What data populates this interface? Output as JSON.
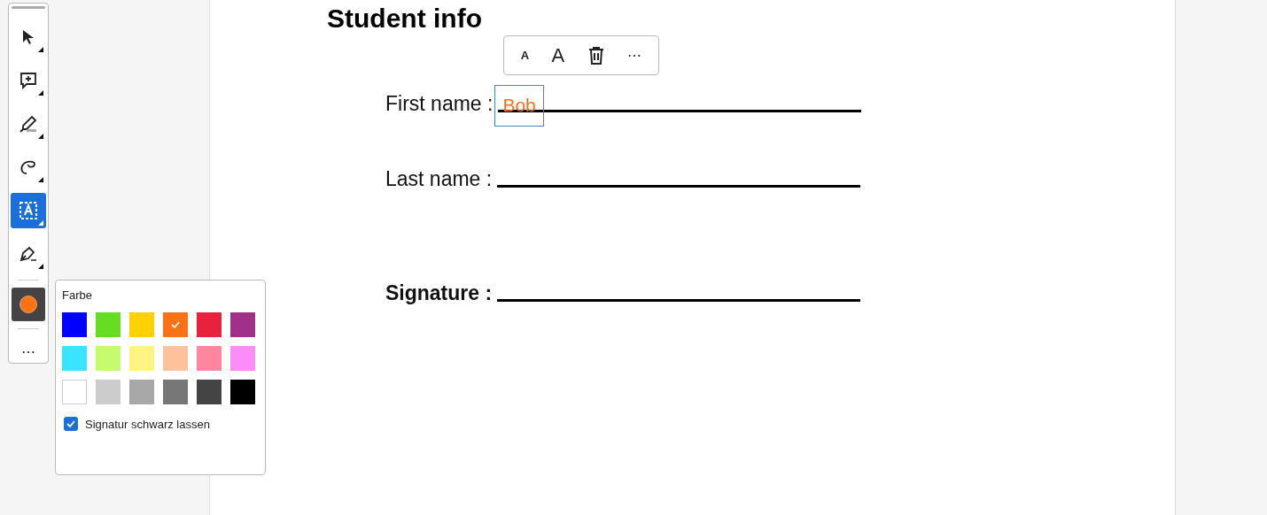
{
  "tools": [
    {
      "kind": "select",
      "selected": false
    },
    {
      "kind": "comment",
      "selected": false
    },
    {
      "kind": "highlight",
      "selected": false
    },
    {
      "kind": "draw",
      "selected": false
    },
    {
      "kind": "textbox",
      "selected": true
    },
    {
      "kind": "sign",
      "selected": false
    }
  ],
  "color_button": {
    "color": "#f97316"
  },
  "more_button": "⋯",
  "palette": {
    "title": "Farbe",
    "swatches": [
      {
        "color": "#0000ff",
        "selected": false
      },
      {
        "color": "#66dd22",
        "selected": false
      },
      {
        "color": "#ffd200",
        "selected": false
      },
      {
        "color": "#f97316",
        "selected": true
      },
      {
        "color": "#e8213c",
        "selected": false
      },
      {
        "color": "#a0308a",
        "selected": false
      },
      {
        "color": "#38e4ff",
        "selected": false
      },
      {
        "color": "#c6fb6e",
        "selected": false
      },
      {
        "color": "#fdf482",
        "selected": false
      },
      {
        "color": "#ffc09c",
        "selected": false
      },
      {
        "color": "#ff869e",
        "selected": false
      },
      {
        "color": "#fd8bf8",
        "selected": false
      },
      {
        "color": "#ffffff",
        "selected": false
      },
      {
        "color": "#cccccc",
        "selected": false
      },
      {
        "color": "#a8a8a8",
        "selected": false
      },
      {
        "color": "#777777",
        "selected": false
      },
      {
        "color": "#444444",
        "selected": false
      },
      {
        "color": "#000000",
        "selected": false
      }
    ],
    "keep_signature_black": {
      "label": "Signatur schwarz lassen",
      "checked": true
    }
  },
  "text_toolbar": {
    "smaller": "A",
    "larger": "A",
    "more": "⋯"
  },
  "document": {
    "title": "Student info",
    "fields": [
      {
        "label": "First name :",
        "bold": false,
        "value": "Bob"
      },
      {
        "label": "Last name :",
        "bold": false
      },
      {
        "label": "Signature :",
        "bold": true
      }
    ]
  }
}
